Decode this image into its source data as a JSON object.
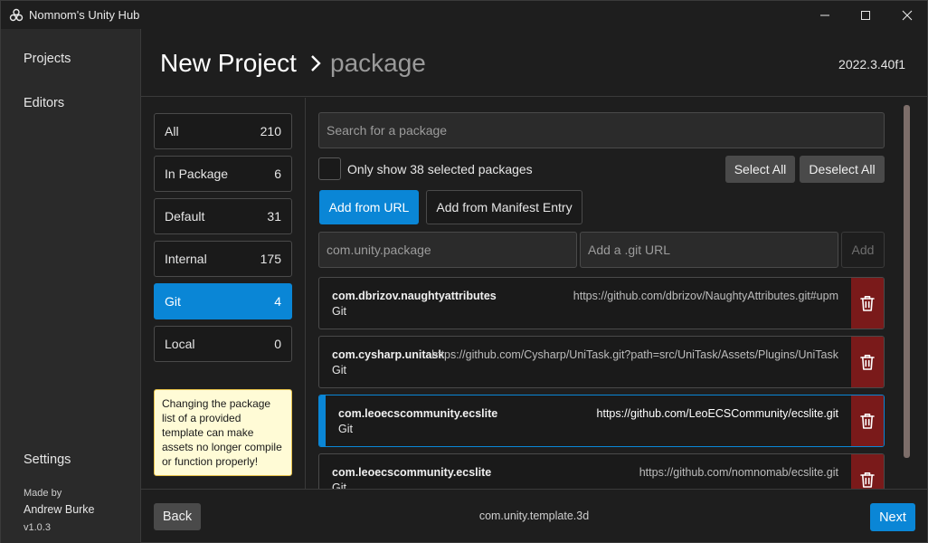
{
  "window": {
    "title": "Nomnom's Unity Hub"
  },
  "nav": {
    "projects": "Projects",
    "editors": "Editors",
    "settings": "Settings",
    "made_by": "Made by",
    "author": "Andrew Burke",
    "version": "v1.0.3"
  },
  "header": {
    "title": "New Project",
    "breadcrumb": "package",
    "unity_version": "2022.3.40f1"
  },
  "categories": [
    {
      "label": "All",
      "count": "210"
    },
    {
      "label": "In Package",
      "count": "6"
    },
    {
      "label": "Default",
      "count": "31"
    },
    {
      "label": "Internal",
      "count": "175"
    },
    {
      "label": "Git",
      "count": "4"
    },
    {
      "label": "Local",
      "count": "0"
    }
  ],
  "warning": "Changing the package list of a provided template can make assets no longer compile or function properly!",
  "search": {
    "placeholder": "Search for a package"
  },
  "filter": {
    "label": "Only show 38 selected packages",
    "select_all": "Select All",
    "deselect_all": "Deselect All"
  },
  "tabs": {
    "add_from_url": "Add from URL",
    "add_from_manifest": "Add from Manifest Entry"
  },
  "add_form": {
    "name_placeholder": "com.unity.package",
    "url_placeholder": "Add a .git URL",
    "add_label": "Add"
  },
  "packages": [
    {
      "name": "com.dbrizov.naughtyattributes",
      "url": "https://github.com/dbrizov/NaughtyAttributes.git#upm",
      "source": "Git"
    },
    {
      "name": "com.cysharp.unitask",
      "url": "https://github.com/Cysharp/UniTask.git?path=src/UniTask/Assets/Plugins/UniTask",
      "source": "Git"
    },
    {
      "name": "com.leoecscommunity.ecslite",
      "url": "https://github.com/LeoECSCommunity/ecslite.git",
      "source": "Git"
    },
    {
      "name": "com.leoecscommunity.ecslite",
      "url": "https://github.com/nomnomab/ecslite.git",
      "source": "Git"
    }
  ],
  "footer": {
    "back": "Back",
    "template": "com.unity.template.3d",
    "next": "Next"
  },
  "colors": {
    "accent": "#0a86d6",
    "delete": "#7a1a1a",
    "warning_bg": "#fffbd6"
  }
}
